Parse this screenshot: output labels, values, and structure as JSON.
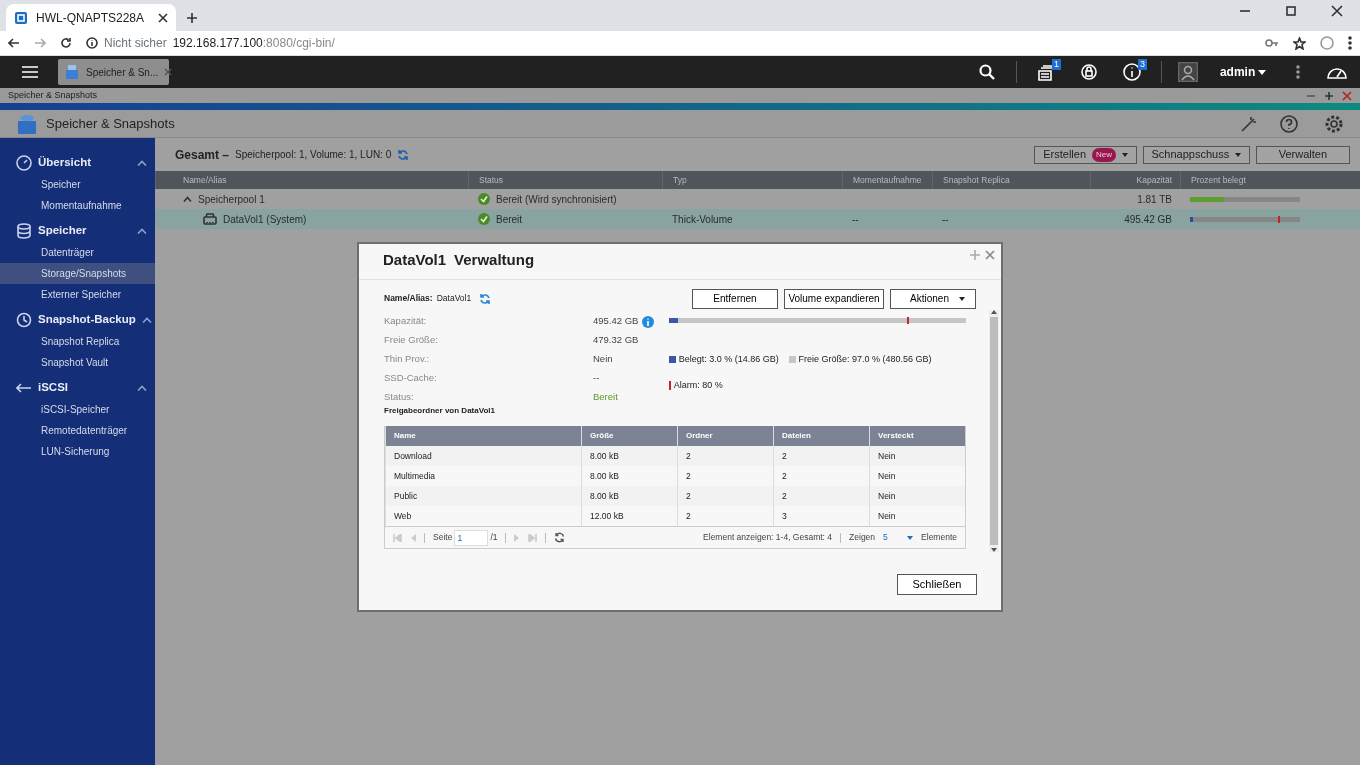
{
  "browser": {
    "tab_title": "HWL-QNAPTS228A",
    "security": "Nicht sicher",
    "url_host": "192.168.177.100",
    "url_rest": ":8080/cgi-bin/"
  },
  "topbar": {
    "app_tab": "Speicher & Sn...",
    "task_badge": "1",
    "info_badge": "3",
    "user": "admin"
  },
  "window": {
    "strip_title": "Speicher & Snapshots",
    "title": "Speicher & Snapshots"
  },
  "sidebar": {
    "sections": [
      {
        "kind": "gauge",
        "label": "Übersicht",
        "expanded": true,
        "items": [
          {
            "label": "Speicher",
            "selected": false
          },
          {
            "label": "Momentaufnahme",
            "selected": false
          }
        ]
      },
      {
        "kind": "database",
        "label": "Speicher",
        "expanded": true,
        "items": [
          {
            "label": "Datenträger",
            "selected": false
          },
          {
            "label": "Storage/Snapshots",
            "selected": true
          },
          {
            "label": "Externer Speicher",
            "selected": false
          }
        ]
      },
      {
        "kind": "backup",
        "label": "Snapshot-Backup",
        "expanded": true,
        "items": [
          {
            "label": "Snapshot Replica",
            "selected": false
          },
          {
            "label": "Snapshot Vault",
            "selected": false
          }
        ]
      },
      {
        "kind": "iscsi",
        "label": "iSCSI",
        "expanded": true,
        "items": [
          {
            "label": "iSCSI-Speicher",
            "selected": false
          },
          {
            "label": "Remotedatenträger",
            "selected": false
          },
          {
            "label": "LUN-Sicherung",
            "selected": false
          }
        ]
      }
    ]
  },
  "summary": {
    "title": "Gesamt",
    "separator": "–",
    "text": "Speicherpool: 1, Volume: 1, LUN: 0"
  },
  "toolbar": [
    {
      "label": "Erstellen",
      "badge": "New",
      "dropdown": true
    },
    {
      "label": "Schnappschuss",
      "dropdown": true
    },
    {
      "label": "Verwalten",
      "dropdown": false
    }
  ],
  "table": {
    "columns": [
      "Name/Alias",
      "Status",
      "Typ",
      "Momentaufnahme",
      "Snapshot Replica",
      "Kapazität",
      "Prozent belegt"
    ],
    "rows": [
      {
        "kind": "pool",
        "name": "Speicherpool 1",
        "expanded": true,
        "status": "Bereit (Wird synchronisiert)",
        "capacity": "1.81 TB",
        "level": 0.31,
        "selected": false
      },
      {
        "kind": "volume",
        "name": "DataVol1 (System)",
        "status": "Bereit",
        "type": "Thick-Volume",
        "snapshot": "--",
        "replica": "--",
        "capacity": "495.42 GB",
        "level": 0.03,
        "alarm": {
          "level": 0.8
        },
        "selected": true
      }
    ]
  },
  "dialog": {
    "title": "DataVol1",
    "subtitle": "Verwaltung",
    "name_label": "Name/Alias:",
    "name_value": "DataVol1",
    "buttons": [
      {
        "label": "Entfernen",
        "dropdown": false
      },
      {
        "label": "Volume expandieren",
        "dropdown": false
      },
      {
        "label": "Aktionen",
        "dropdown": true
      }
    ],
    "properties": [
      {
        "label": "Kapazität:",
        "value": "495.42 GB",
        "info": true
      },
      {
        "label": "Freie Größe:",
        "value": "479.32 GB"
      },
      {
        "label": "Thin Prov.:",
        "value": "Nein"
      },
      {
        "label": "SSD-Cache:",
        "value": "--"
      },
      {
        "label": "Status:",
        "value": "Bereit",
        "kind": "status"
      }
    ],
    "usage": {
      "level": 0.03,
      "alarm": {
        "level": 0.8
      }
    },
    "legend": [
      {
        "kind": "box",
        "label": "Belegt: 3.0 % (14.86 GB)",
        "color": "#3b55a8"
      },
      {
        "kind": "box",
        "label": "Freie Größe: 97.0 % (480.56 GB)",
        "color": "#c6c6c6"
      },
      {
        "kind": "line",
        "label": "Alarm: 80 %",
        "color": "#c0272d"
      }
    ],
    "shares_heading": "Freigabeordner von DataVol1",
    "shares": {
      "columns": [
        "Name",
        "Größe",
        "Ordner",
        "Dateien",
        "Versteckt"
      ],
      "rows": [
        [
          "Download",
          "8.00 kB",
          "2",
          "2",
          "Nein"
        ],
        [
          "Multimedia",
          "8.00 kB",
          "2",
          "2",
          "Nein"
        ],
        [
          "Public",
          "8.00 kB",
          "2",
          "2",
          "Nein"
        ],
        [
          "Web",
          "12.00 kB",
          "2",
          "3",
          "Nein"
        ]
      ]
    },
    "pager": {
      "page_label": "Seite",
      "page": "1",
      "total": "/1",
      "summary": "Element anzeigen: 1-4, Gesamt: 4",
      "show_label": "Zeigen",
      "per_page": "5",
      "items_label": "Elemente"
    },
    "close_button": "Schließen"
  }
}
